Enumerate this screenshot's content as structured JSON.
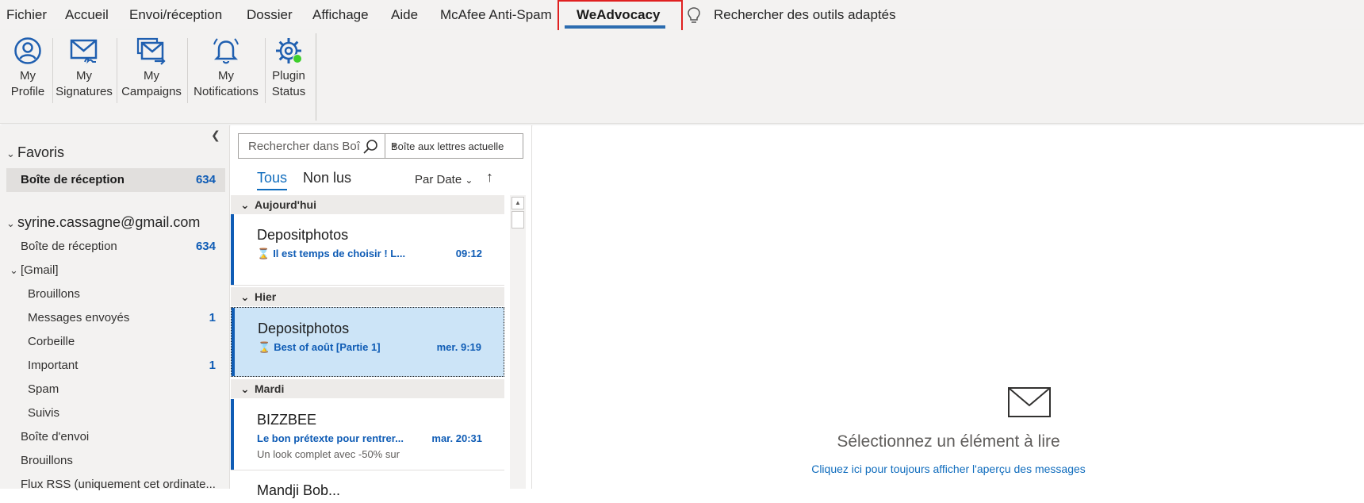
{
  "menu": {
    "tabs": [
      {
        "label": "Fichier"
      },
      {
        "label": "Accueil"
      },
      {
        "label": "Envoi/réception"
      },
      {
        "label": "Dossier"
      },
      {
        "label": "Affichage"
      },
      {
        "label": "Aide"
      },
      {
        "label": "McAfee Anti-Spam"
      },
      {
        "label": "WeAdvocacy",
        "active": true
      }
    ],
    "tell_me": "Rechercher des outils adaptés"
  },
  "ribbon": {
    "buttons": [
      {
        "line1": "My",
        "line2": "Profile",
        "icon": "user-circle-icon"
      },
      {
        "line1": "My",
        "line2": "Signatures",
        "icon": "envelope-signature-icon"
      },
      {
        "line1": "My",
        "line2": "Campaigns",
        "icon": "envelope-send-icon"
      },
      {
        "line1": "My",
        "line2": "Notifications",
        "icon": "bell-icon"
      },
      {
        "line1": "Plugin",
        "line2": "Status",
        "icon": "gear-status-icon"
      }
    ]
  },
  "folders": {
    "favorites": {
      "title": "Favoris",
      "inbox": {
        "label": "Boîte de réception",
        "count": "634"
      }
    },
    "account": {
      "name": "syrine.cassagne@gmail.com",
      "inbox": {
        "label": "Boîte de réception",
        "count": "634"
      },
      "gmail": {
        "label": "[Gmail]",
        "items": [
          {
            "label": "Brouillons",
            "count": ""
          },
          {
            "label": "Messages envoyés",
            "count": "1"
          },
          {
            "label": "Corbeille",
            "count": ""
          },
          {
            "label": "Important",
            "count": "1"
          },
          {
            "label": "Spam",
            "count": ""
          },
          {
            "label": "Suivis",
            "count": ""
          }
        ]
      },
      "outbox": "Boîte d'envoi",
      "drafts": "Brouillons",
      "rss": "Flux RSS (uniquement cet ordinate..."
    }
  },
  "list": {
    "search_placeholder": "Rechercher dans Boî",
    "scope": "Boîte aux lettres actuelle",
    "tabs": {
      "all": "Tous",
      "unread": "Non lus"
    },
    "sort": "Par Date",
    "groups": [
      {
        "label": "Aujourd'hui",
        "messages": [
          {
            "sender": "Depositphotos",
            "subject": "Il est temps de choisir ! L...",
            "time": "09:12",
            "preview": ""
          }
        ]
      },
      {
        "label": "Hier",
        "messages": [
          {
            "sender": "Depositphotos",
            "subject": "Best of août [Partie 1]",
            "time": "mer. 9:19",
            "preview": ""
          }
        ]
      },
      {
        "label": "Mardi",
        "messages": [
          {
            "sender": "BIZZBEE",
            "subject": "Le bon prétexte pour rentrer...",
            "time": "mar. 20:31",
            "preview": "Un look complet avec -50% sur"
          },
          {
            "sender": "Mandji Bob...",
            "subject": "",
            "time": "",
            "preview": ""
          }
        ]
      }
    ]
  },
  "reading": {
    "title": "Sélectionnez un élément à lire",
    "link": "Cliquez ici pour toujours afficher l'aperçu des messages"
  },
  "colors": {
    "accent": "#0f6cbd",
    "unread_blue": "#0f5cb5",
    "highlight_red": "#e02020",
    "selected_row": "#cce4f7",
    "chrome": "#f3f2f1"
  }
}
